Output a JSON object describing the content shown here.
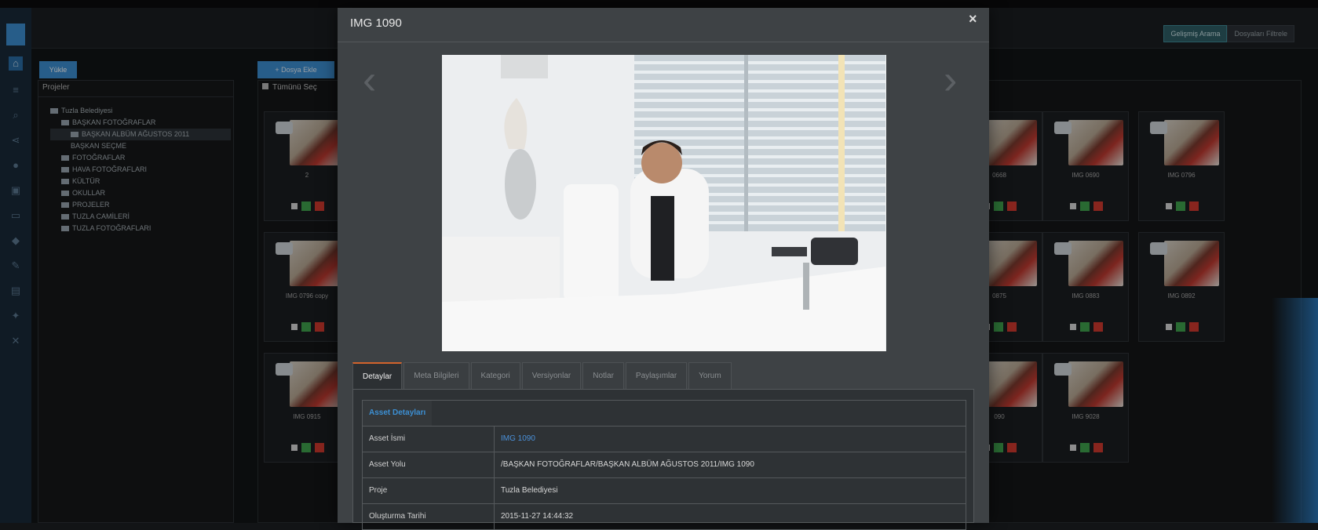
{
  "header": {
    "tabs": [
      "Gelişmiş Arama",
      "Dosyaları Filtrele"
    ]
  },
  "sidebar": {
    "icons": [
      "home-icon",
      "list-icon",
      "search-icon",
      "share-icon",
      "user-icon",
      "image-icon",
      "folder-icon",
      "tag-icon",
      "edit-icon",
      "chart-icon",
      "settings-icon",
      "tools-icon"
    ]
  },
  "tree": {
    "button": "Yükle",
    "title": "Projeler",
    "nodes": [
      {
        "label": "Tuzla Belediyesi"
      },
      {
        "label": "BAŞKAN FOTOĞRAFLAR"
      },
      {
        "label": "BAŞKAN ALBÜM AĞUSTOS 2011"
      },
      {
        "label": "BAŞKAN SEÇME"
      },
      {
        "label": "FOTOĞRAFLAR"
      },
      {
        "label": "HAVA FOTOĞRAFLARI"
      },
      {
        "label": "KÜLTÜR"
      },
      {
        "label": "OKULLAR"
      },
      {
        "label": "PROJELER"
      },
      {
        "label": "TUZLA CAMİLERİ"
      },
      {
        "label": "TUZLA FOTOĞRAFLARI"
      }
    ]
  },
  "grid": {
    "add_button": "+ Dosya Ekle",
    "select_all": "Tümünü Seç",
    "cards": [
      {
        "label": "2"
      },
      {
        "label": "0668"
      },
      {
        "label": "IMG 0690"
      },
      {
        "label": "IMG 0796"
      },
      {
        "label": "IMG 0796 copy"
      },
      {
        "label": "0875"
      },
      {
        "label": "IMG 0883"
      },
      {
        "label": "IMG 0892"
      },
      {
        "label": "IMG 0915"
      },
      {
        "label": "090"
      },
      {
        "label": "IMG 9028"
      }
    ]
  },
  "modal": {
    "title": "IMG 1090",
    "close": "×",
    "prev": "‹",
    "next": "›",
    "tabs": [
      "Detaylar",
      "Meta Bilgileri",
      "Kategori",
      "Versiyonlar",
      "Notlar",
      "Paylaşımlar",
      "Yorum"
    ],
    "details": {
      "header": "Asset Detayları",
      "rows": [
        {
          "key": "Asset İsmi",
          "value": "IMG 1090"
        },
        {
          "key": "Asset Yolu",
          "value": "/BAŞKAN FOTOĞRAFLAR/BAŞKAN ALBÜM AĞUSTOS 2011/IMG 1090"
        },
        {
          "key": "Proje",
          "value": "Tuzla Belediyesi"
        },
        {
          "key": "Oluşturma Tarihi",
          "value": "2015-11-27 14:44:32"
        }
      ]
    }
  }
}
